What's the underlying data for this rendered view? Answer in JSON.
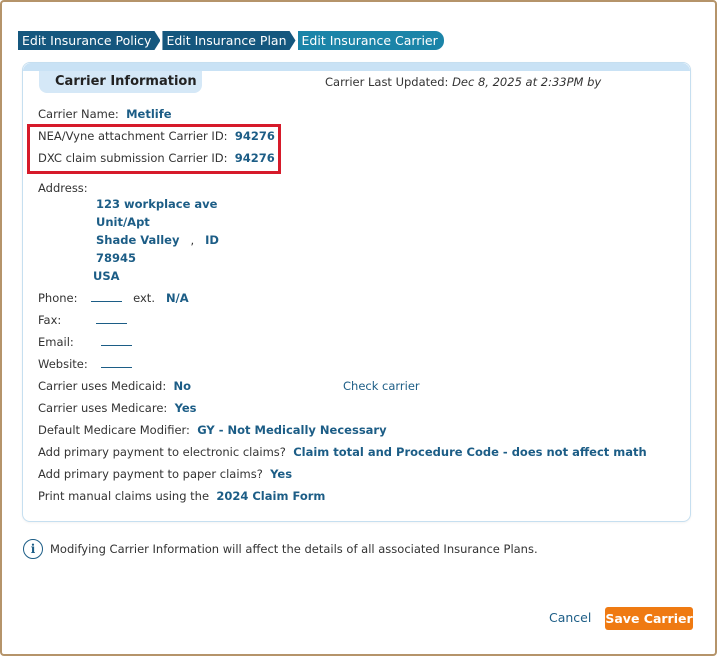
{
  "tabs": [
    "Edit Insurance Policy",
    "Edit Insurance Plan",
    "Edit Insurance Carrier"
  ],
  "panel": {
    "title": "Carrier Information",
    "updated_label": "Carrier Last Updated:",
    "updated_value": "Dec 8, 2025 at 2:33PM by"
  },
  "fields": {
    "carrier_name_label": "Carrier Name:",
    "carrier_name": "Metlife",
    "nea_label": "NEA/Vyne attachment Carrier ID:",
    "nea_id": "94276",
    "dxc_label": "DXC claim submission Carrier ID:",
    "dxc_id": "94276",
    "address_label": "Address:",
    "address_line1": "123 workplace ave",
    "address_line2": "Unit/Apt",
    "city": "Shade Valley",
    "comma": ",",
    "state": "ID",
    "zip": "78945",
    "country": "USA",
    "phone_label": "Phone:",
    "ext_label": "ext.",
    "ext_value": "N/A",
    "fax_label": "Fax:",
    "email_label": "Email:",
    "website_label": "Website:",
    "medicaid_label": "Carrier uses Medicaid:",
    "medicaid_value": "No",
    "check_carrier": "Check carrier",
    "medicare_label": "Carrier uses Medicare:",
    "medicare_value": "Yes",
    "modifier_label": "Default Medicare Modifier:",
    "modifier_value": "GY - Not Medically Necessary",
    "electronic_label": "Add primary payment to electronic claims?",
    "electronic_value": "Claim total and Procedure Code - does not affect math",
    "paper_label": "Add primary payment to paper claims?",
    "paper_value": "Yes",
    "print_label": "Print manual claims using the",
    "print_value": "2024 Claim Form"
  },
  "info": {
    "icon": "i",
    "text": "Modifying Carrier Information will affect the details of all associated Insurance Plans."
  },
  "buttons": {
    "cancel": "Cancel",
    "save": "Save Carrier"
  },
  "colors": {
    "accent": "#1c5d86",
    "save": "#ef7a12",
    "highlight": "#d61a2a",
    "tab": "#15577e",
    "tab_active": "#1b84a8"
  }
}
